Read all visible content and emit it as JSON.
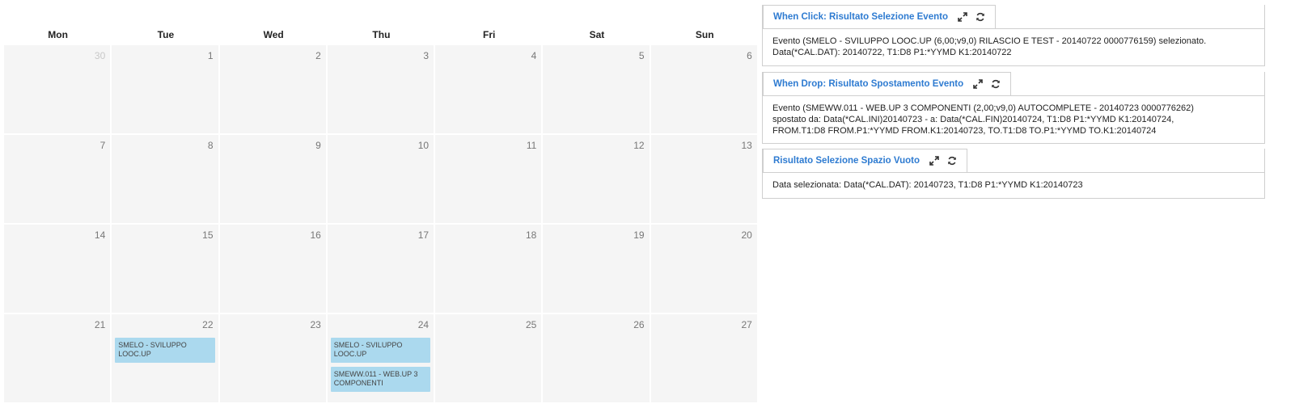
{
  "calendar": {
    "weekdays": [
      "Mon",
      "Tue",
      "Wed",
      "Thu",
      "Fri",
      "Sat",
      "Sun"
    ],
    "weeks": [
      [
        "30",
        "1",
        "2",
        "3",
        "4",
        "5",
        "6"
      ],
      [
        "7",
        "8",
        "9",
        "10",
        "11",
        "12",
        "13"
      ],
      [
        "14",
        "15",
        "16",
        "17",
        "18",
        "19",
        "20"
      ],
      [
        "21",
        "22",
        "23",
        "24",
        "25",
        "26",
        "27"
      ]
    ],
    "events": {
      "tue22_a": "SMELO - SVILUPPO LOOC.UP",
      "thu24_a": "SMELO - SVILUPPO LOOC.UP",
      "thu24_b": "SMEWW.011 - WEB.UP 3 COMPONENTI"
    },
    "event_color": "#abd9ee"
  },
  "panels": {
    "click": {
      "title": "When Click: Risultato Selezione Evento",
      "line1": "Evento (SMELO - SVILUPPO LOOC.UP (6,00;v9,0) RILASCIO E TEST - 20140722 0000776159) selezionato.",
      "line2": "Data(*CAL.DAT): 20140722, T1:D8 P1:*YYMD K1:20140722"
    },
    "drop": {
      "title": "When Drop: Risultato Spostamento Evento",
      "line1": "Evento (SMEWW.011 - WEB.UP 3 COMPONENTI (2,00;v9,0) AUTOCOMPLETE - 20140723 0000776262)",
      "line2": "spostato da: Data(*CAL.INI)20140723 - a: Data(*CAL.FIN)20140724, T1:D8 P1:*YYMD K1:20140724,",
      "line3": "FROM.T1:D8 FROM.P1:*YYMD FROM.K1:20140723, TO.T1:D8 TO.P1:*YYMD TO.K1:20140724"
    },
    "empty": {
      "title": "Risultato Selezione Spazio Vuoto",
      "line1": "Data selezionata: Data(*CAL.DAT): 20140723, T1:D8 P1:*YYMD K1:20140723"
    },
    "icons": [
      "expand-icon",
      "refresh-icon"
    ],
    "title_color": "#2e7bd1"
  }
}
